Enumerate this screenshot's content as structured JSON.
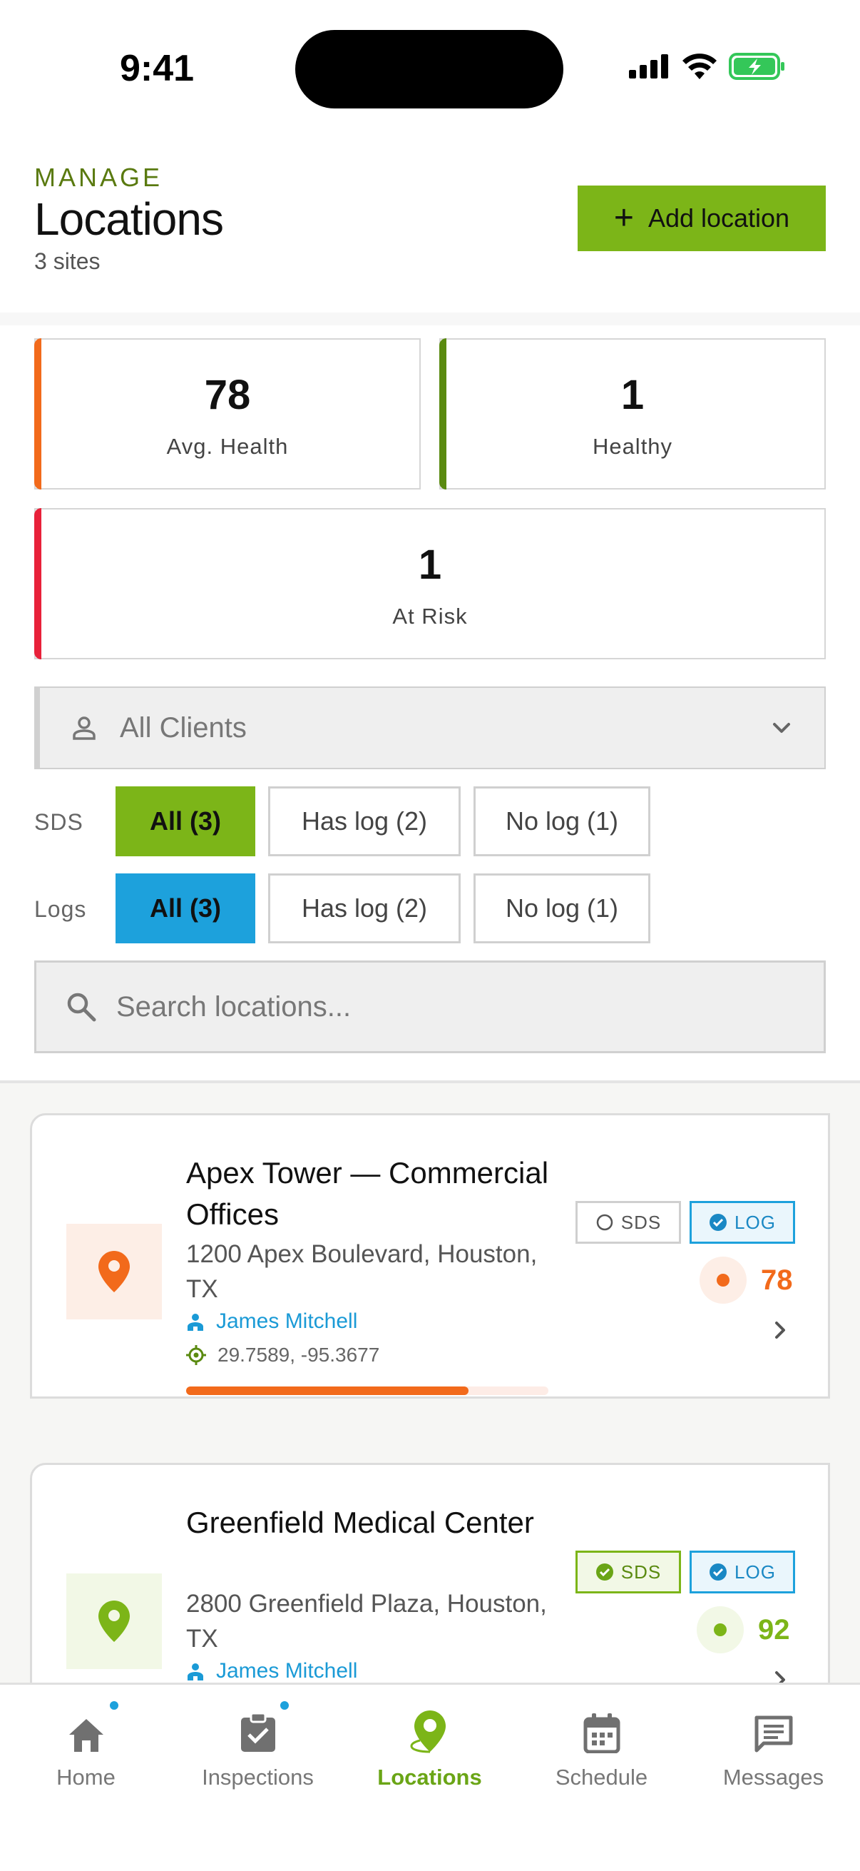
{
  "status_bar": {
    "time": "9:41"
  },
  "header": {
    "eyebrow": "MANAGE",
    "title": "Locations",
    "subtitle": "3 sites",
    "add_button_label": "Add location"
  },
  "stats": [
    {
      "value": "78",
      "label": "Avg. Health",
      "accent": "#f26a1b"
    },
    {
      "value": "1",
      "label": "Healthy",
      "accent": "#5a8a10"
    },
    {
      "value": "1",
      "label": "At Risk",
      "accent": "#e8213a"
    }
  ],
  "client_filter": {
    "selected": "All Clients"
  },
  "filters": {
    "sds": {
      "label": "SDS",
      "options": [
        "All (3)",
        "Has log (2)",
        "No log (1)"
      ],
      "selected": "All (3)"
    },
    "logs": {
      "label": "Logs",
      "options": [
        "All (3)",
        "Has log (2)",
        "No log (1)"
      ],
      "selected": "All (3)"
    }
  },
  "search": {
    "placeholder": "Search locations..."
  },
  "locations": [
    {
      "name": "Apex Tower — Commercial Offices",
      "address": "1200 Apex Boulevard, Houston, TX",
      "owner": "James Mitchell",
      "coords": "29.7589, -95.3677",
      "sds_badge": "SDS",
      "sds_on": false,
      "log_badge": "LOG",
      "log_on": true,
      "score": "78",
      "health": 0.78,
      "color": "#f26a1b"
    },
    {
      "name": "Greenfield Medical Center",
      "address": "2800 Greenfield Plaza, Houston, TX",
      "owner": "James Mitchell",
      "sds_badge": "SDS",
      "sds_on": true,
      "log_badge": "LOG",
      "log_on": true,
      "score": "92",
      "color": "#7cb518"
    }
  ],
  "tabs": [
    {
      "label": "Home",
      "icon": "home-icon",
      "badge": true
    },
    {
      "label": "Inspections",
      "icon": "clipboard-check-icon",
      "badge": true
    },
    {
      "label": "Locations",
      "icon": "location-pin-icon",
      "active": true
    },
    {
      "label": "Schedule",
      "icon": "calendar-icon"
    },
    {
      "label": "Messages",
      "icon": "message-icon"
    }
  ],
  "colors": {
    "brand_green": "#7cb518",
    "accent_blue": "#1da1dc",
    "warning_orange": "#f26a1b",
    "danger_red": "#e8213a"
  }
}
